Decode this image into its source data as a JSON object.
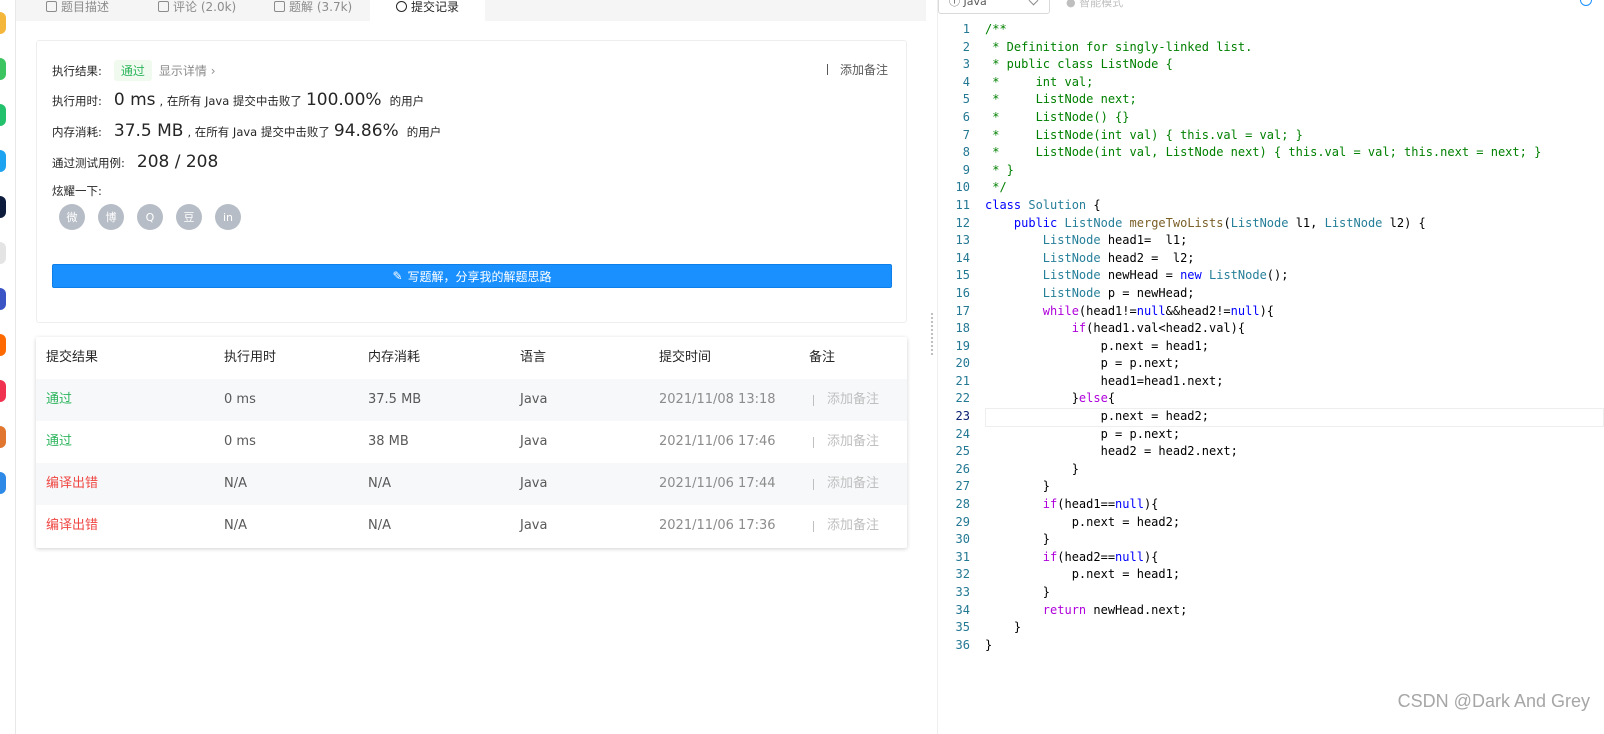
{
  "tabs": [
    {
      "label": "题目描述",
      "icon": "document-icon"
    },
    {
      "label": "评论 (2.0k)",
      "icon": "comment-icon"
    },
    {
      "label": "题解 (3.7k)",
      "icon": "flask-icon"
    },
    {
      "label": "提交记录",
      "icon": "clock-icon"
    }
  ],
  "result": {
    "status_label": "执行结果:",
    "status_value": "通过",
    "detail_link": "显示详情 ›",
    "add_note": "添加备注",
    "runtime_label": "执行用时:",
    "runtime_value": "0 ms",
    "runtime_mid": ", 在所有 Java 提交中击败了",
    "runtime_pct": "100.00%",
    "users_suffix": "的用户",
    "memory_label": "内存消耗:",
    "memory_value": "37.5 MB",
    "memory_mid": ", 在所有 Java 提交中击败了",
    "memory_pct": "94.86%",
    "cases_label": "通过测试用例:",
    "cases_value": "208 / 208",
    "share_label": "炫耀一下:",
    "share_icons": [
      "wechat-icon",
      "weibo-icon",
      "qq-icon",
      "douban-icon",
      "linkedin-icon"
    ],
    "share_glyphs": [
      "微",
      "博",
      "Q",
      "豆",
      "in"
    ],
    "write_button": "写题解，分享我的解题思路"
  },
  "table": {
    "headers": [
      "提交结果",
      "执行用时",
      "内存消耗",
      "语言",
      "提交时间",
      "备注"
    ],
    "rows": [
      {
        "status": "通过",
        "status_kind": "pass",
        "runtime": "0 ms",
        "memory": "37.5 MB",
        "lang": "Java",
        "time": "2021/11/08 13:18",
        "note": "添加备注"
      },
      {
        "status": "通过",
        "status_kind": "pass",
        "runtime": "0 ms",
        "memory": "38 MB",
        "lang": "Java",
        "time": "2021/11/06 17:46",
        "note": "添加备注"
      },
      {
        "status": "编译出错",
        "status_kind": "error",
        "runtime": "N/A",
        "memory": "N/A",
        "lang": "Java",
        "time": "2021/11/06 17:44",
        "note": "添加备注"
      },
      {
        "status": "编译出错",
        "status_kind": "error",
        "runtime": "N/A",
        "memory": "N/A",
        "lang": "Java",
        "time": "2021/11/06 17:36",
        "note": "添加备注"
      }
    ]
  },
  "editor": {
    "language": "Java",
    "mode_label": "智能模式",
    "current_line": 23,
    "code_lines": [
      "/**",
      " * Definition for singly-linked list.",
      " * public class ListNode {",
      " *     int val;",
      " *     ListNode next;",
      " *     ListNode() {}",
      " *     ListNode(int val) { this.val = val; }",
      " *     ListNode(int val, ListNode next) { this.val = val; this.next = next; }",
      " * }",
      " */",
      "class Solution {",
      "    public ListNode mergeTwoLists(ListNode l1, ListNode l2) {",
      "        ListNode head1=  l1;",
      "        ListNode head2 =  l2;",
      "        ListNode newHead = new ListNode();",
      "        ListNode p = newHead;",
      "        while(head1!=null&&head2!=null){",
      "            if(head1.val<head2.val){",
      "                p.next = head1;",
      "                p = p.next;",
      "                head1=head1.next;",
      "            }else{",
      "                p.next = head2;",
      "                p = p.next;",
      "                head2 = head2.next;",
      "            }",
      "        }",
      "        if(head1==null){",
      "            p.next = head2;",
      "        }",
      "        if(head2==null){",
      "            p.next = head1;",
      "        }",
      "        return newHead.next;",
      "    }",
      "}"
    ]
  },
  "watermark": "CSDN @Dark And Grey",
  "colors": {
    "accent": "#1a90ff",
    "pass": "#2db55d",
    "error": "#ef4743"
  }
}
